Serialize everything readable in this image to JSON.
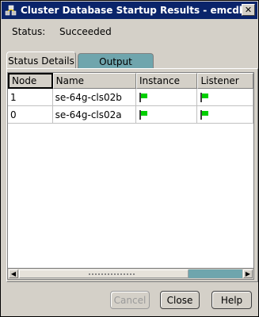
{
  "window": {
    "title": "Cluster Database Startup Results - emcdb",
    "close_glyph": "✕"
  },
  "status": {
    "label": "Status:",
    "value": "Succeeded"
  },
  "tabs": [
    {
      "label": "Status Details",
      "selected": true
    },
    {
      "label": "Output",
      "selected": false
    }
  ],
  "table": {
    "columns": [
      "Node",
      "Name",
      "Instance",
      "Listener"
    ],
    "rows": [
      {
        "node": "1",
        "name": "se-64g-cls02b",
        "instance": "flag-green-icon",
        "listener": "flag-green-icon"
      },
      {
        "node": "0",
        "name": "se-64g-cls02a",
        "instance": "flag-green-icon",
        "listener": "flag-green-icon"
      }
    ]
  },
  "buttons": {
    "cancel": "Cancel",
    "close": "Close",
    "help": "Help"
  },
  "colors": {
    "titlebar": "#0a246a",
    "tab_accent": "#6fa5ad",
    "flag_green": "#00d000"
  }
}
